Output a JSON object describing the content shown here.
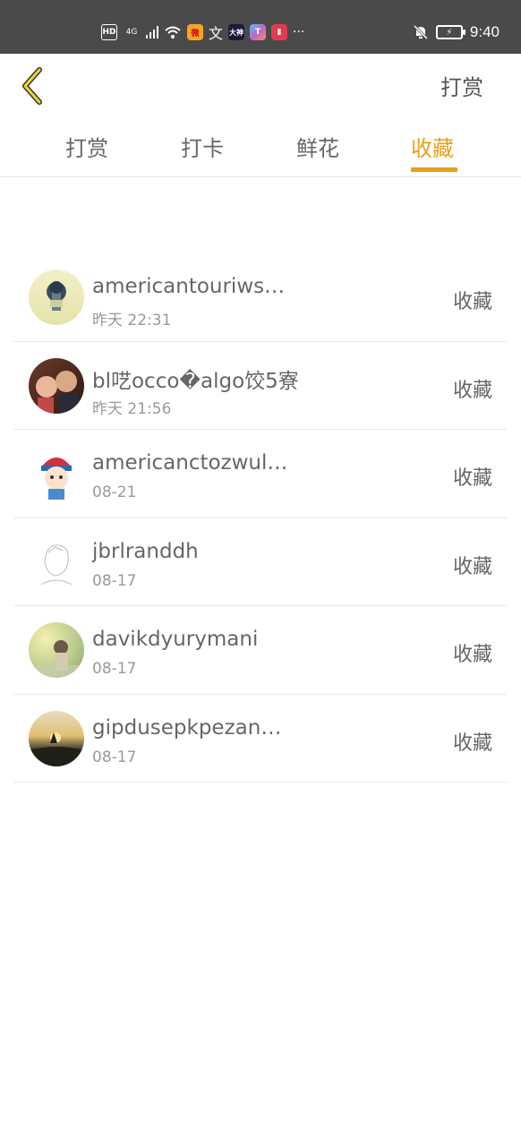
{
  "status_bar": {
    "hd": "HD",
    "network": "4G",
    "app_icon_2": "文",
    "app_icon_3": "大神",
    "more": "···",
    "time": "9:40"
  },
  "header": {
    "right_label": "打赏"
  },
  "tabs": [
    {
      "label": "打赏",
      "active": false
    },
    {
      "label": "打卡",
      "active": false
    },
    {
      "label": "鲜花",
      "active": false
    },
    {
      "label": "收藏",
      "active": true
    }
  ],
  "accent_color": "#e4a01e",
  "list": [
    {
      "name": "americantouriws…",
      "time": "昨天 22:31",
      "action": "收藏"
    },
    {
      "name": "bl呓occo�algo饺5寮",
      "time": "昨天 21:56",
      "action": "收藏"
    },
    {
      "name": "americanctozwul…",
      "time": "08-21",
      "action": "收藏"
    },
    {
      "name": "jbrlranddh",
      "time": "08-17",
      "action": "收藏"
    },
    {
      "name": "davikdyurymani",
      "time": "08-17",
      "action": "收藏"
    },
    {
      "name": "gipdusepkpezan…",
      "time": "08-17",
      "action": "收藏"
    }
  ]
}
